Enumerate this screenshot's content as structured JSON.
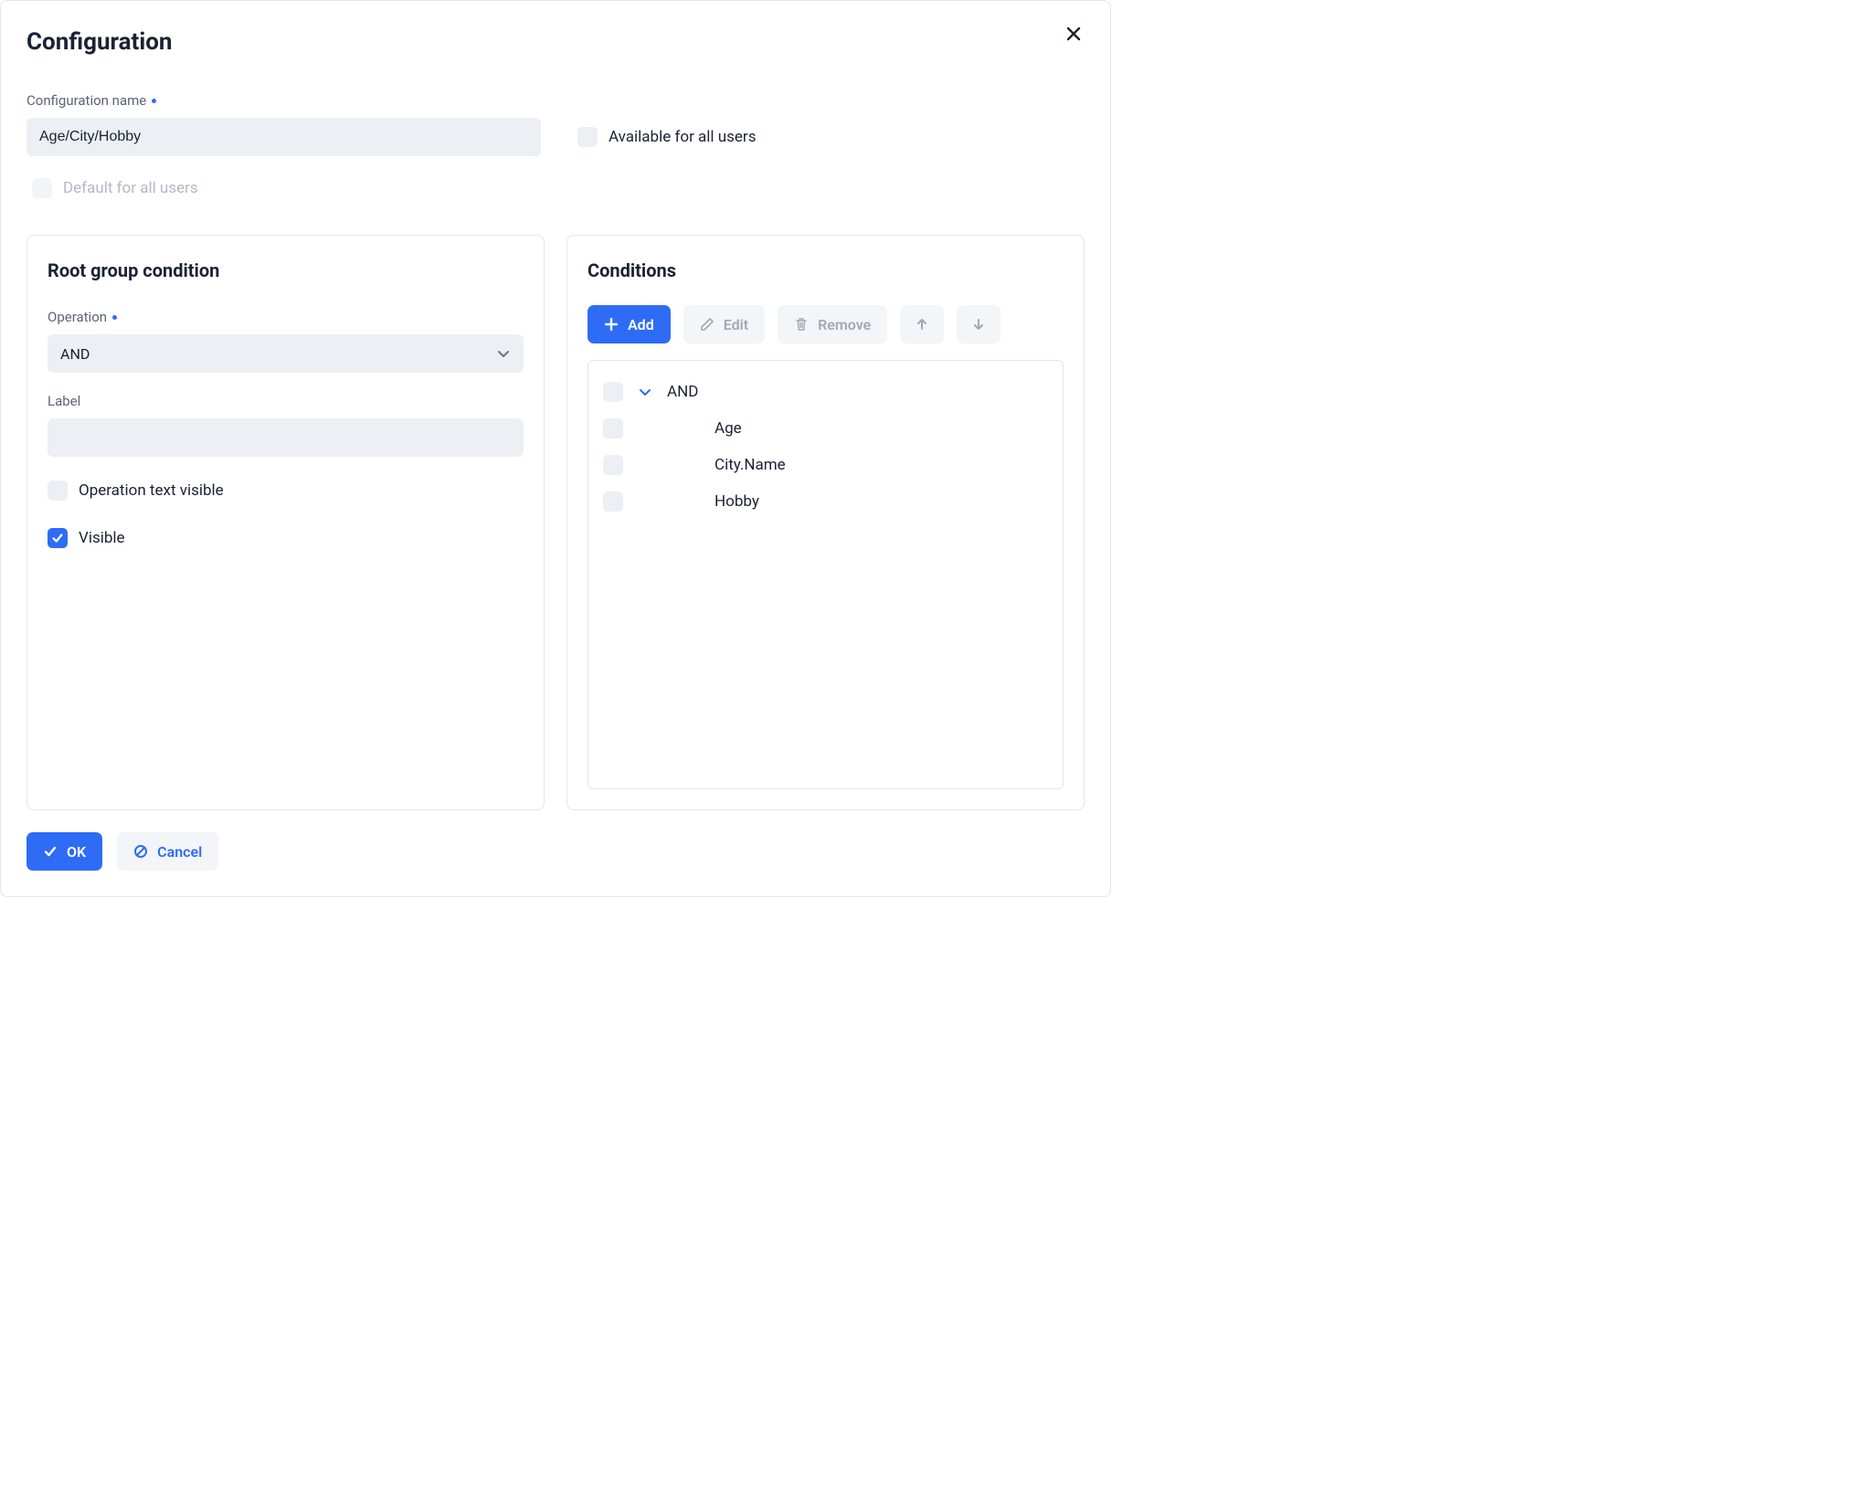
{
  "dialog": {
    "title": "Configuration"
  },
  "form": {
    "name_label": "Configuration name",
    "name_value": "Age/City/Hobby",
    "available_label": "Available for all users",
    "available_checked": false,
    "default_label": "Default for all users",
    "default_checked": false,
    "default_disabled": true
  },
  "root_group": {
    "title": "Root group condition",
    "operation_label": "Operation",
    "operation_value": "AND",
    "label_label": "Label",
    "label_value": "",
    "op_text_visible_label": "Operation text visible",
    "op_text_visible_checked": false,
    "visible_label": "Visible",
    "visible_checked": true
  },
  "conditions": {
    "title": "Conditions",
    "toolbar": {
      "add": "Add",
      "edit": "Edit",
      "remove": "Remove"
    },
    "tree": {
      "root_label": "AND",
      "items": [
        "Age",
        "City.Name",
        "Hobby"
      ]
    }
  },
  "footer": {
    "ok": "OK",
    "cancel": "Cancel"
  }
}
